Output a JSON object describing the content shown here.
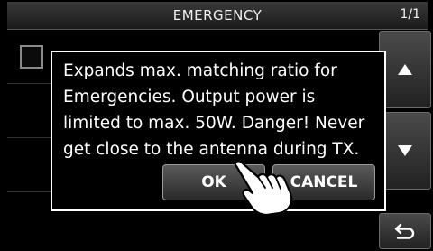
{
  "header": {
    "title": "EMERGENCY",
    "page_indicator": "1/1"
  },
  "dialog": {
    "message": "Expands max. matching ratio for\nEmergencies. Output power is\nlimited to max. 50W. Danger! Never\nget close to the antenna during TX.",
    "ok_label": "OK",
    "cancel_label": "CANCEL"
  },
  "sidebar": {
    "up_icon": "triangle-up-icon",
    "down_icon": "triangle-down-icon",
    "back_icon": "return-arrow-icon"
  },
  "list": {
    "checkbox_checked": false
  },
  "colors": {
    "background": "#000000",
    "text": "#ffffff",
    "dialog_border": "#ffffff"
  }
}
